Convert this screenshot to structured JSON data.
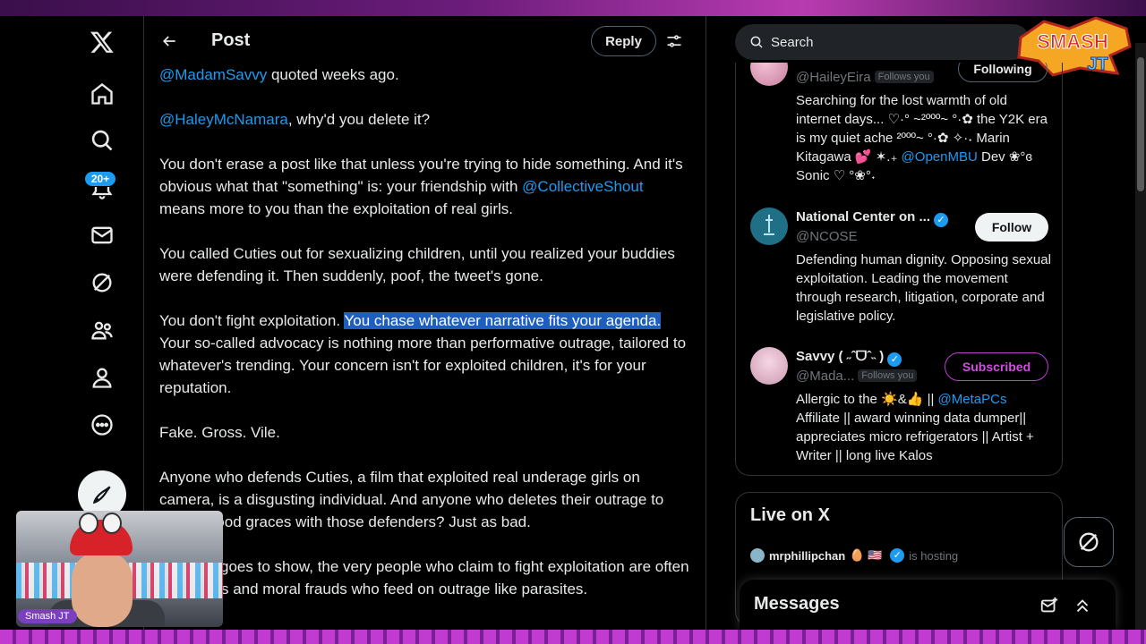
{
  "header": {
    "title": "Post",
    "reply_label": "Reply"
  },
  "nav": {
    "notification_badge": "20+"
  },
  "post": {
    "p1": {
      "mention": "@MadamSavvy",
      "text": " quoted weeks ago."
    },
    "p2": {
      "mention": "@HaleyMcNamara",
      "text": ", why'd you delete it?"
    },
    "p3": {
      "pre": "You don't erase a post like that unless you're trying to hide something. And it's obvious what that \"something\" is: your friendship with ",
      "mention": "@CollectiveShout",
      "post": " means more to you than the exploitation of real girls."
    },
    "p4": "You called Cuties out for sexualizing children, until you realized your buddies were defending it. Then suddenly, poof, the tweet's gone.",
    "p5": {
      "pre": "You don't fight exploitation. ",
      "highlight": "You chase whatever narrative fits your agenda.",
      "post": " Your so-called advocacy is nothing more than performative outrage, tailored to whatever's trending. Your concern isn't for exploited children, it's for your reputation."
    },
    "p6": "Fake. Gross. Vile.",
    "p7": "Anyone who defends Cuties, a film that exploited real underage girls on camera, is a disgusting individual. And anyone who deletes their outrage to stay in good graces with those defenders? Just as bad.",
    "p8": "This just goes to show, the very people who claim to fight exploitation are often hypocrites and moral frauds who feed on outrage like parasites."
  },
  "webcam": {
    "tag": "Smash JT"
  },
  "search": {
    "placeholder": "Search"
  },
  "overlay_logo": {
    "line1": "SMASH",
    "line2": "JT"
  },
  "who_to_follow": [
    {
      "name": "",
      "handle": "@HaileyEira",
      "follows_you": "Follows you",
      "button": "Following",
      "bio_pre": "Searching for the lost warmth of old internet days... ♡·° ~²ººº~ °·✿ the Y2K era is my quiet ache ²ººº~ °·✿ ✧·˖ Marin Kitagawa 💕 ✶.₊ ",
      "bio_mention": "@OpenMBU",
      "bio_post": " Dev ❀°ɞ Sonic ♡ °❀°˖"
    },
    {
      "name": "National Center on ...",
      "handle": "@NCOSE",
      "button": "Follow",
      "bio": "Defending human dignity. Opposing sexual exploitation. Leading the movement through research, litigation, corporate and legislative policy."
    },
    {
      "name": "Savvy ( ˶ˆᗜˆ˵ )",
      "handle": "@Mada...",
      "follows_you": "Follows you",
      "button": "Subscribed",
      "bio_pre": "Allergic to the ☀️&👍 || ",
      "bio_mention": "@MetaPCs",
      "bio_post": " Affiliate || award winning data dumper|| appreciates micro refrigerators || Artist + Writer || long live Kalos"
    }
  ],
  "live": {
    "title": "Live on X",
    "host": "mrphillipchan",
    "host_flags": "🥚 🇺🇸",
    "status": "is hosting"
  },
  "messages": {
    "title": "Messages"
  },
  "colors": {
    "accent": "#1d9bf0",
    "background": "#000000",
    "text": "#e7e9ea",
    "muted": "#71767b",
    "highlight": "#1d5ebf",
    "subscribed": "#c13bd1"
  }
}
